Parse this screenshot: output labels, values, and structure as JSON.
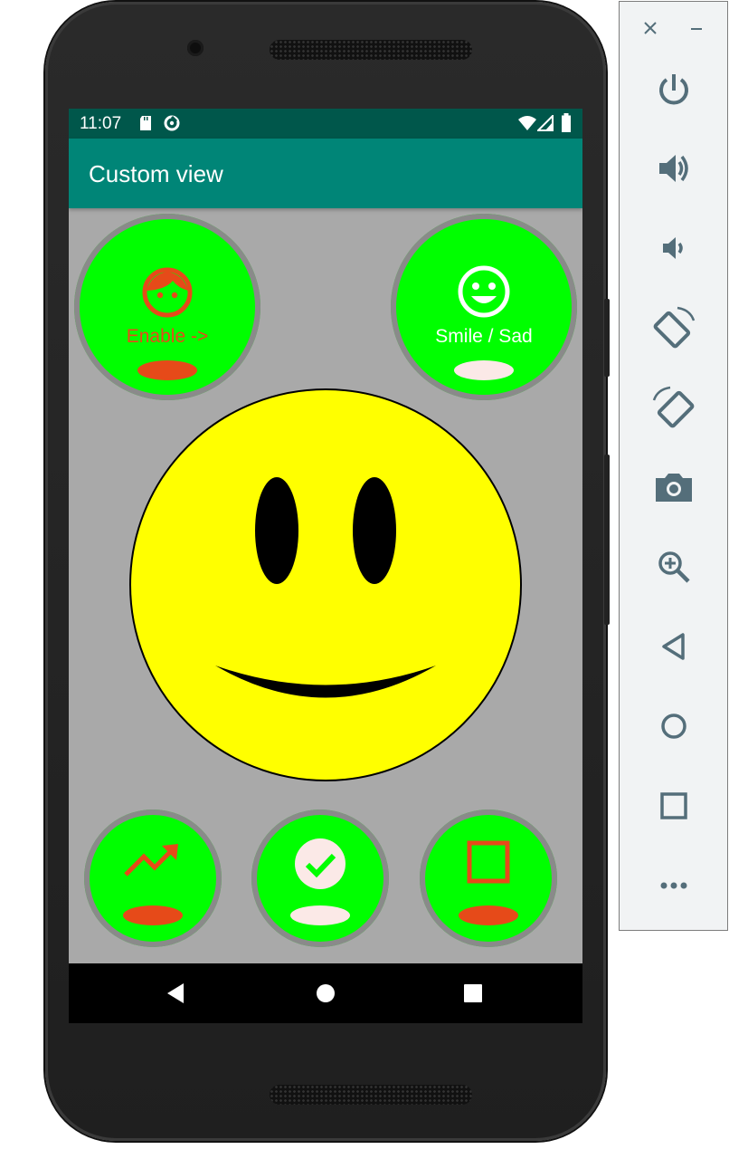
{
  "status_bar": {
    "time": "11:07",
    "icons": [
      "sd-card-icon",
      "data-saver-icon",
      "wifi-icon",
      "cellular-icon",
      "battery-icon"
    ]
  },
  "app_bar": {
    "title": "Custom view"
  },
  "controls": {
    "enable_button": {
      "label": "Enable ->",
      "icon": "face-icon",
      "indicator_color": "#e64a19"
    },
    "smile_sad_button": {
      "label": "Smile / Sad",
      "icon": "smiley-icon",
      "indicator_color": "#fbe9e7"
    },
    "trend_button": {
      "icon": "trending-up-icon",
      "indicator_color": "#e64a19"
    },
    "check_button": {
      "icon": "check-circle-icon",
      "indicator_color": "#fbe9e7"
    },
    "square_button": {
      "icon": "square-outline-icon",
      "indicator_color": "#e64a19"
    }
  },
  "smiley_view": {
    "mood": "smile",
    "face_color": "#ffff00"
  },
  "nav_bar": {
    "buttons": [
      "back-icon",
      "home-icon",
      "recents-icon"
    ]
  },
  "emulator_panel": {
    "buttons": [
      "close-icon",
      "minimize-icon",
      "power-icon",
      "volume-up-icon",
      "volume-down-icon",
      "rotate-left-icon",
      "rotate-right-icon",
      "screenshot-icon",
      "zoom-icon",
      "back-icon",
      "home-icon",
      "overview-icon",
      "more-icon"
    ]
  },
  "colors": {
    "status_bar": "#00574b",
    "app_bar": "#008577",
    "button_green": "#00ff00",
    "accent_red": "#e64a19",
    "background_gray": "#a9a9a9"
  }
}
